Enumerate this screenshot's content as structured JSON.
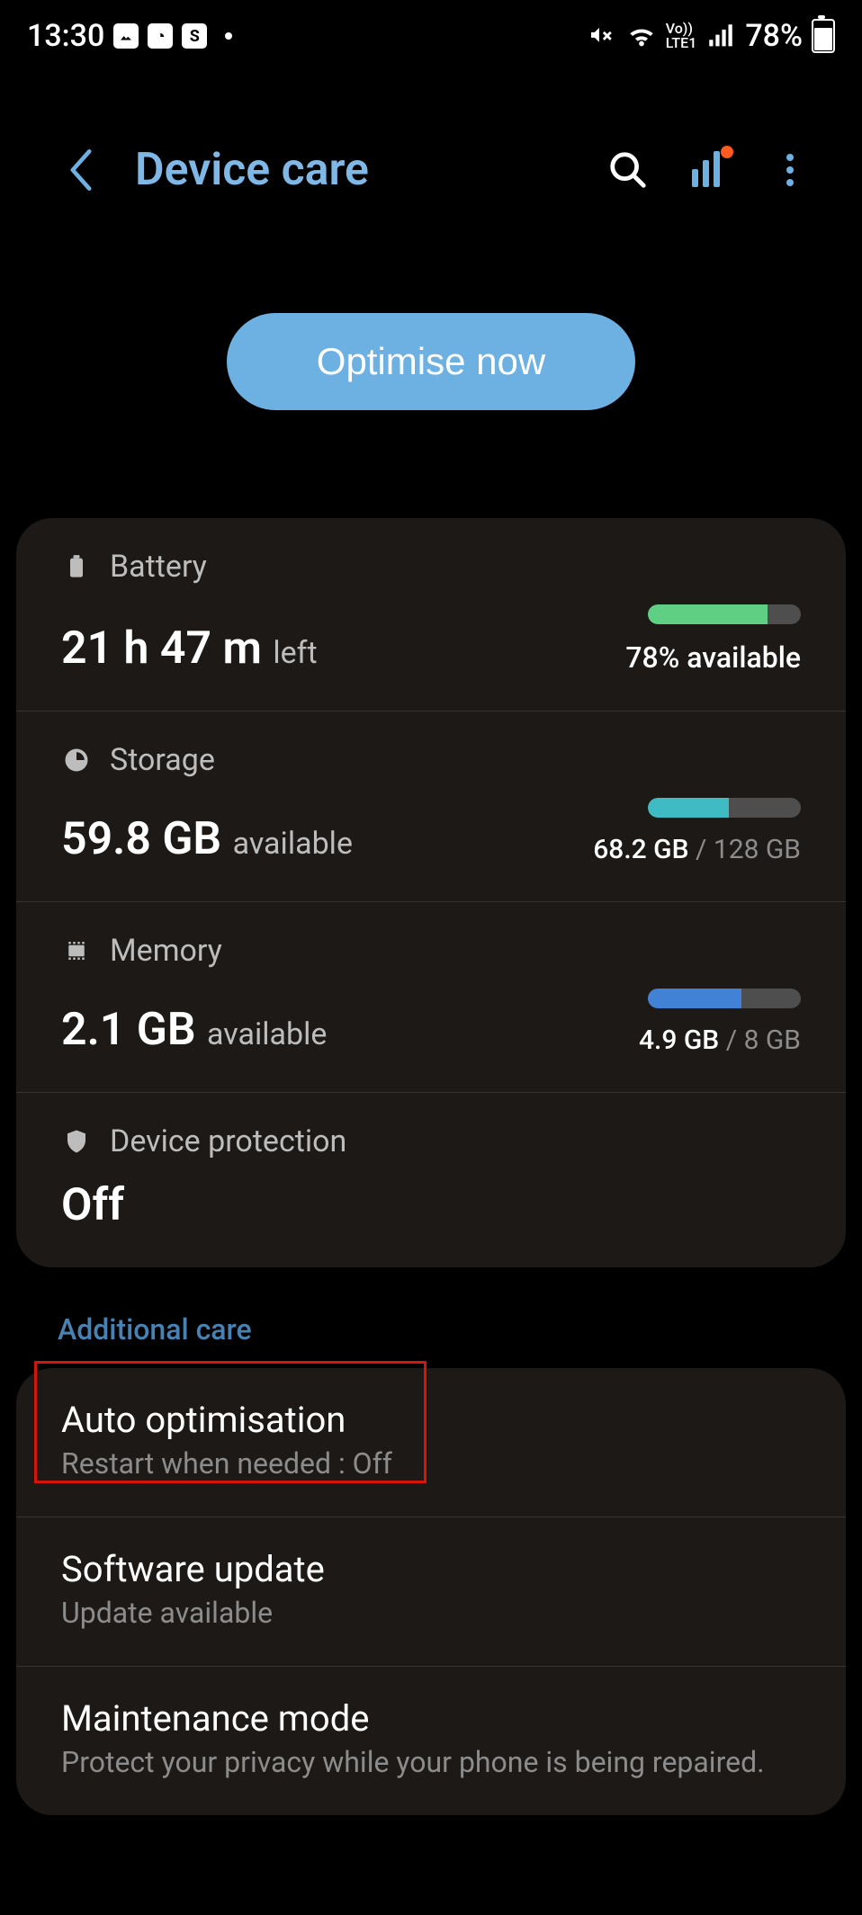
{
  "status": {
    "time": "13:30",
    "battery_pct": "78%",
    "lte_line1": "Vo))",
    "lte_line2": "LTE1"
  },
  "header": {
    "title": "Device care"
  },
  "optimise_label": "Optimise now",
  "battery": {
    "label": "Battery",
    "value_main": "21 h 47 m",
    "value_suffix": "left",
    "right_text": "78% available",
    "fill_pct": 78,
    "fill_color": "#5fcf83"
  },
  "storage": {
    "label": "Storage",
    "value_main": "59.8 GB",
    "value_suffix": "available",
    "ratio_used": "68.2 GB",
    "ratio_total": "128 GB",
    "fill_pct": 53,
    "fill_color": "#3fbbc3"
  },
  "memory": {
    "label": "Memory",
    "value_main": "2.1 GB",
    "value_suffix": "available",
    "ratio_used": "4.9 GB",
    "ratio_total": "8 GB",
    "fill_pct": 61,
    "fill_color": "#4181d6"
  },
  "protection": {
    "label": "Device protection",
    "status": "Off"
  },
  "section_label": "Additional care",
  "auto_opt": {
    "title": "Auto optimisation",
    "sub": "Restart when needed : Off"
  },
  "software": {
    "title": "Software update",
    "sub": "Update available"
  },
  "maintenance": {
    "title": "Maintenance mode",
    "sub": "Protect your privacy while your phone is being repaired."
  }
}
